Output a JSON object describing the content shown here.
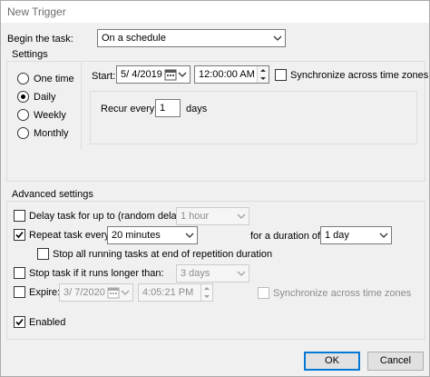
{
  "window": {
    "title": "New Trigger"
  },
  "begin": {
    "label": "Begin the task:",
    "value": "On a schedule"
  },
  "settings": {
    "label": "Settings",
    "schedule_options": [
      "One time",
      "Daily",
      "Weekly",
      "Monthly"
    ],
    "selected": "Daily",
    "start_label": "Start:",
    "start_date": "5/  4/2019",
    "start_time": "12:00:00 AM",
    "sync_label": "Synchronize across time zones",
    "sync_checked": false,
    "recur_label": "Recur every:",
    "recur_value": "1",
    "recur_unit": "days"
  },
  "advanced": {
    "label": "Advanced settings",
    "delay": {
      "label": "Delay task for up to (random delay):",
      "checked": false,
      "value": "1 hour"
    },
    "repeat": {
      "label": "Repeat task every:",
      "checked": true,
      "value": "20 minutes",
      "duration_label": "for a duration of:",
      "duration_value": "1 day"
    },
    "stop_running": {
      "label": "Stop all running tasks at end of repetition duration",
      "checked": false
    },
    "stop_longer": {
      "label": "Stop task if it runs longer than:",
      "checked": false,
      "value": "3 days"
    },
    "expire": {
      "label": "Expire:",
      "checked": false,
      "date": "3/  7/2020",
      "time": "4:05:21 PM",
      "sync_label": "Synchronize across time zones"
    },
    "enabled": {
      "label": "Enabled",
      "checked": true
    }
  },
  "buttons": {
    "ok": "OK",
    "cancel": "Cancel"
  },
  "colors": {
    "accent": "#0078d7",
    "background": "#f0f0f0"
  }
}
